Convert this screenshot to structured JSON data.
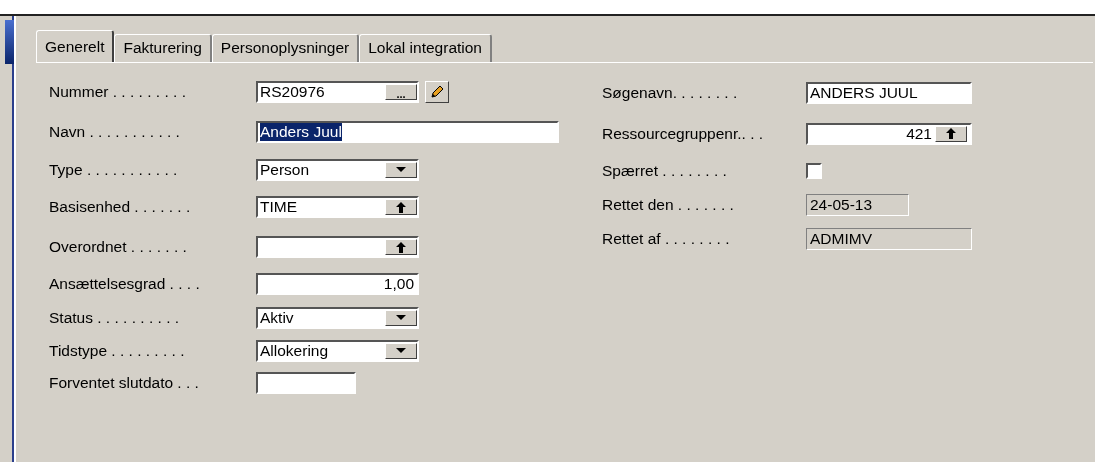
{
  "tabs": [
    {
      "label": "Generelt",
      "selected": true
    },
    {
      "label": "Fakturering",
      "selected": false
    },
    {
      "label": "Personoplysninger",
      "selected": false
    },
    {
      "label": "Lokal integration",
      "selected": false
    }
  ],
  "left_fields": [
    {
      "label": "Nummer . . . . . . . . .",
      "kind": "assist",
      "value": "RS20976",
      "button_label": "..."
    },
    {
      "label": "Navn . . . . . . . . . . .",
      "kind": "text",
      "value": "Anders Juul",
      "selected": true
    },
    {
      "label": "Type . . . . . . . . . . .",
      "kind": "dropdown",
      "value": "Person"
    },
    {
      "label": "Basisenhed . . . . . . .",
      "kind": "lookup",
      "value": "TIME"
    },
    {
      "label": "Overordnet . . . . . . .",
      "kind": "lookup"
    },
    {
      "label": "Ansættelsesgrad . . . .",
      "kind": "number",
      "value": "1,00"
    },
    {
      "label": "Status . . . . . . . . . .",
      "kind": "dropdown",
      "value": "Aktiv"
    },
    {
      "label": "Tidstype . . . . . . . . .",
      "kind": "dropdown",
      "value": "Allokering"
    },
    {
      "label": "Forventet slutdato . . .",
      "kind": "text"
    }
  ],
  "right_fields": [
    {
      "label": "Søgenavn. . . . . . . .",
      "kind": "text",
      "value": "ANDERS  JUUL"
    },
    {
      "label": "Ressourcegruppenr.. . .",
      "kind": "lookup_number",
      "value": "421"
    },
    {
      "label": "Spærret . . . . . . . .",
      "kind": "checkbox",
      "checked": false
    },
    {
      "label": "Rettet den . . . . . . .",
      "kind": "readonly",
      "value": "24-05-13"
    },
    {
      "label": "Rettet af . . . . . . . .",
      "kind": "readonly",
      "value": "ADMIMV"
    }
  ]
}
